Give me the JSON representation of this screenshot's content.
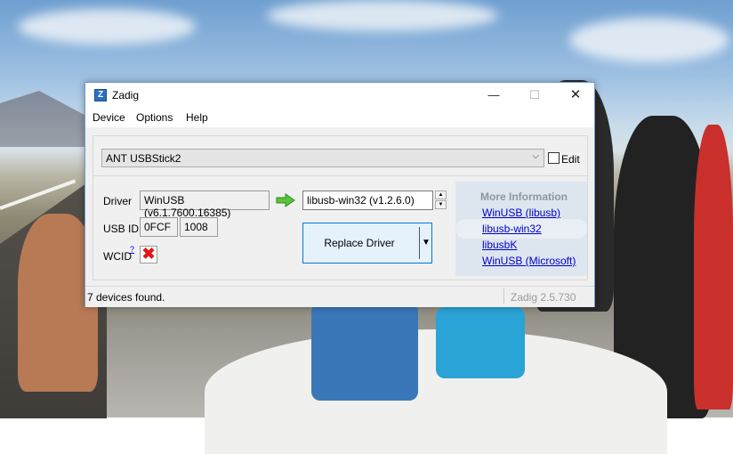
{
  "window": {
    "title": "Zadig",
    "icon_letter": "Z",
    "controls": {
      "minimize": "—",
      "maximize": "☐",
      "close": "✕"
    }
  },
  "menu": {
    "items": [
      "Device",
      "Options",
      "Help"
    ]
  },
  "device": {
    "selected": "ANT USBStick2",
    "edit_label": "Edit",
    "edit_checked": false
  },
  "driver": {
    "label": "Driver",
    "current": "WinUSB (v6.1.7600.16385)",
    "target": "libusb-win32 (v1.2.6.0)",
    "arrow_icon": "green-right-arrow"
  },
  "usb_id": {
    "label": "USB ID",
    "vid": "0FCF",
    "pid": "1008"
  },
  "wcid": {
    "label": "WCID",
    "help_mark": "?",
    "status_icon": "red-x",
    "status_glyph": "✖"
  },
  "replace_button": {
    "label": "Replace Driver",
    "dropdown_glyph": "▼"
  },
  "more_info": {
    "title": "More Information",
    "links": [
      "WinUSB (libusb)",
      "libusb-win32",
      "libusbK",
      "WinUSB (Microsoft)"
    ]
  },
  "status": {
    "message": "7 devices found.",
    "version": "Zadig 2.5.730"
  },
  "colors": {
    "accent_border": "#0078d7",
    "link": "#0000cc",
    "error": "#e01818"
  }
}
